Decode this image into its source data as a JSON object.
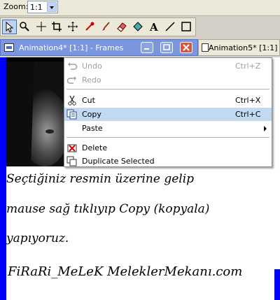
{
  "zoom": {
    "label": "Zoom:",
    "value": "1:1"
  },
  "tools": [
    {
      "name": "selection-arrow-icon"
    },
    {
      "name": "magnifier-icon"
    },
    {
      "name": "crosshair-icon"
    },
    {
      "name": "crop-icon"
    },
    {
      "name": "move-icon"
    },
    {
      "name": "dropper-icon"
    },
    {
      "name": "paintbrush-icon"
    },
    {
      "name": "eraser-icon"
    },
    {
      "name": "fill-icon"
    },
    {
      "name": "text-icon"
    },
    {
      "name": "line-icon"
    },
    {
      "name": "rectangle-icon"
    }
  ],
  "windows": {
    "active_title": "Animation4* [1:1] - Frames",
    "inactive_title": "Animation5* [1:1] -"
  },
  "context_menu": {
    "items": [
      {
        "label": "Undo",
        "shortcut": "Ctrl+Z",
        "disabled": true,
        "icon": "undo-icon"
      },
      {
        "label": "Redo",
        "shortcut": "",
        "disabled": true,
        "icon": "redo-icon"
      },
      {
        "label": "Cut",
        "shortcut": "Ctrl+X",
        "disabled": false,
        "icon": "scissors-icon"
      },
      {
        "label": "Copy",
        "shortcut": "Ctrl+C",
        "disabled": false,
        "highlighted": true,
        "icon": "copy-icon"
      },
      {
        "label": "Paste",
        "shortcut": "",
        "disabled": false,
        "submenu": true
      },
      {
        "label": "Delete",
        "shortcut": "",
        "disabled": false,
        "icon": "delete-icon"
      },
      {
        "label": "Duplicate Selected",
        "shortcut": "",
        "disabled": false,
        "icon": "duplicate-icon"
      }
    ]
  },
  "captions": {
    "line1": "Seçtiğiniz resmin üzerine gelip",
    "line2": "mause sağ tıklıyıp Copy (kopyala)",
    "line3": "yapıyoruz.",
    "signature": "FiRaRi_MeLeK  MeleklerMekanı.com"
  },
  "colors": {
    "accent_blue": "#0000ff",
    "menu_highlight": "#c1daf0",
    "title_bar": "#7a96df"
  }
}
